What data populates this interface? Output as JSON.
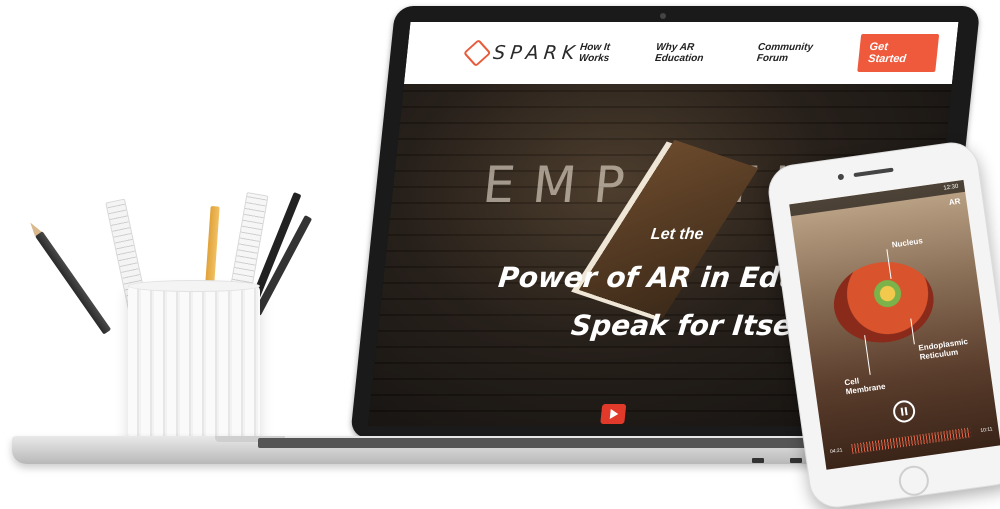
{
  "site": {
    "logo_text": "SPARK",
    "nav": [
      "How It Works",
      "Why AR Education",
      "Community Forum"
    ],
    "cta_label": "Get Started",
    "accent_color": "#ef5a3d"
  },
  "hero": {
    "background_word": "EMP  YTH",
    "pre_title": "Let the",
    "title_line1": "Power of AR in Education",
    "title_line2": "Speak for Itself",
    "play_icon": "play-icon"
  },
  "phone": {
    "status_time": "12:30",
    "app_badge": "AR",
    "labels": {
      "nucleus": "Nucleus",
      "er": "Endoplasmic Reticulum",
      "membrane": "Cell Membrane"
    },
    "time_elapsed": "04:21",
    "time_total": "10:11",
    "pause_icon": "pause-icon"
  }
}
